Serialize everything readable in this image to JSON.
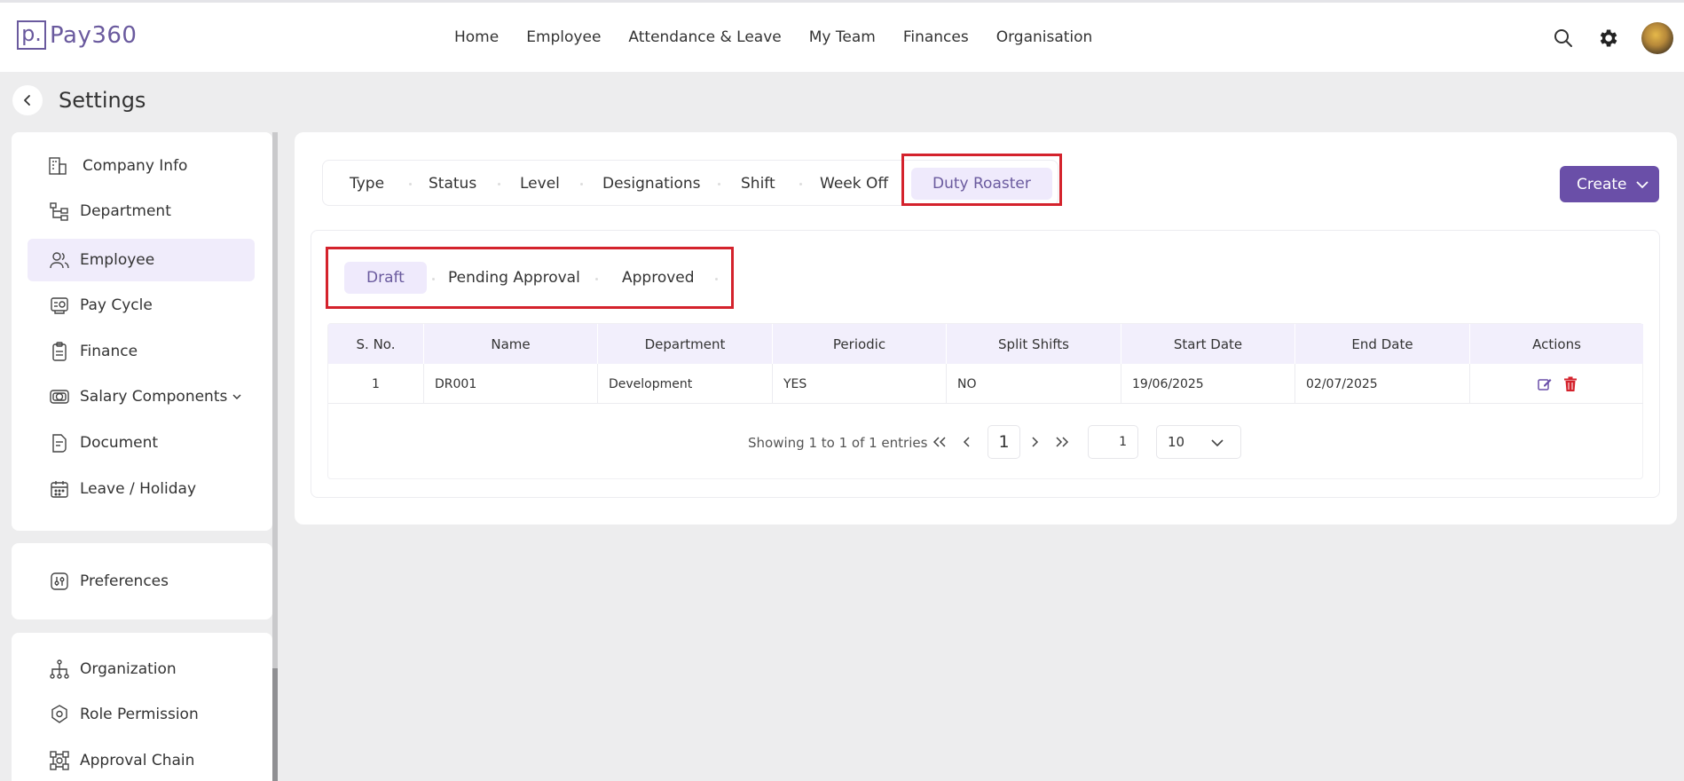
{
  "app": {
    "logo_mark": "p.",
    "logo_text": "Pay360"
  },
  "nav": {
    "items": [
      "Home",
      "Employee",
      "Attendance & Leave",
      "My Team",
      "Finances",
      "Organisation"
    ]
  },
  "page": {
    "title": "Settings"
  },
  "sidebar": {
    "group1": [
      "Company Info",
      "Department",
      "Employee",
      "Pay Cycle",
      "Finance",
      "Salary Components",
      "Document",
      "Leave / Holiday"
    ],
    "group2": [
      "Preferences"
    ],
    "group3": [
      "Organization",
      "Role Permission",
      "Approval Chain"
    ],
    "active": "Employee"
  },
  "tabs": {
    "items": [
      "Type",
      "Status",
      "Level",
      "Designations",
      "Shift",
      "Week Off",
      "Duty Roaster"
    ],
    "active": "Duty Roaster"
  },
  "create": {
    "label": "Create"
  },
  "subtabs": {
    "items": [
      "Draft",
      "Pending Approval",
      "Approved"
    ],
    "active": "Draft"
  },
  "table": {
    "headers": [
      "S. No.",
      "Name",
      "Department",
      "Periodic",
      "Split Shifts",
      "Start Date",
      "End Date",
      "Actions"
    ],
    "rows": [
      [
        "1",
        "DR001",
        "Development",
        "YES",
        "NO",
        "19/06/2025",
        "02/07/2025"
      ]
    ]
  },
  "pagination": {
    "summary": "Showing 1 to 1 of 1 entries",
    "current_page": "1",
    "goto_value": "1",
    "page_size": "10"
  },
  "colors": {
    "brand": "#6a4fa8",
    "highlight": "#d4222c",
    "active_bg": "#efeafc"
  }
}
